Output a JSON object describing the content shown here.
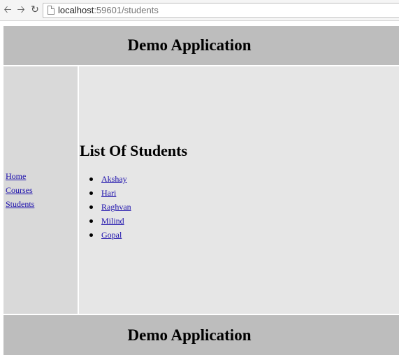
{
  "browser": {
    "back_icon": "arrow-left-icon",
    "forward_icon": "arrow-right-icon",
    "reload_icon": "reload-icon",
    "url_host": "localhost",
    "url_path": ":59601/students"
  },
  "header": {
    "title": "Demo Application"
  },
  "sidebar": {
    "items": [
      {
        "label": "Home"
      },
      {
        "label": "Courses"
      },
      {
        "label": "Students"
      }
    ]
  },
  "main": {
    "heading": "List Of Students",
    "students": [
      "Akshay",
      "Hari",
      "Raghvan",
      "Milind",
      "Gopal"
    ]
  },
  "footer": {
    "title": "Demo Application"
  },
  "colors": {
    "header_bg": "#bdbdbd",
    "sidebar_bg": "#d9d9d9",
    "main_bg": "#e6e6e6",
    "link": "#1a0dab"
  }
}
